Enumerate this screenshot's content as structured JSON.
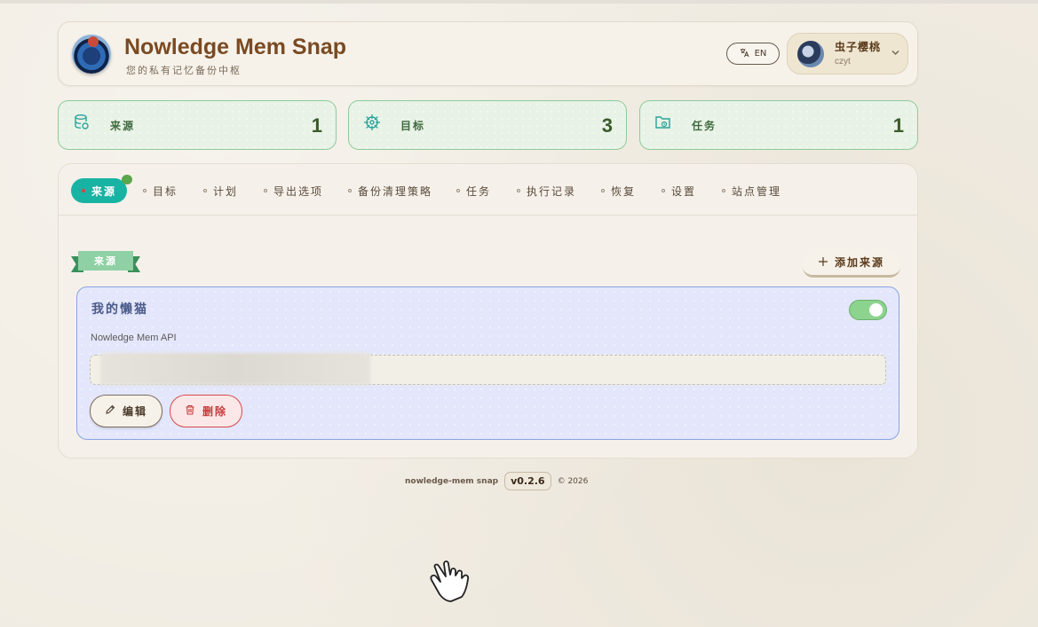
{
  "header": {
    "title": "Nowledge Mem Snap",
    "subtitle": "您的私有记忆备份中枢",
    "lang_button": "EN",
    "user": {
      "name": "虫子樱桃",
      "id": "czyt"
    }
  },
  "stats": [
    {
      "label": "来源",
      "value": "1",
      "icon": "database-refresh-icon"
    },
    {
      "label": "目标",
      "value": "3",
      "icon": "helm-icon"
    },
    {
      "label": "任务",
      "value": "1",
      "icon": "folder-clock-icon"
    }
  ],
  "tabs": [
    "来源",
    "目标",
    "计划",
    "导出选项",
    "备份清理策略",
    "任务",
    "执行记录",
    "恢复",
    "设置",
    "站点管理"
  ],
  "section": {
    "ribbon": "来源",
    "add_button": "添加来源"
  },
  "source_card": {
    "name": "我的懒猫",
    "type": "Nowledge Mem API",
    "enabled": true,
    "edit_label": "编辑",
    "delete_label": "删除"
  },
  "footer": {
    "brand": "nowledge-mem snap",
    "version": "v0.2.6",
    "copyright": "© 2026"
  },
  "colors": {
    "accent": "#19b3a3",
    "brand": "#7a4a22",
    "stat_border": "#8fcb9a",
    "card_border": "#8aa3e2",
    "danger": "#d44a4a"
  }
}
